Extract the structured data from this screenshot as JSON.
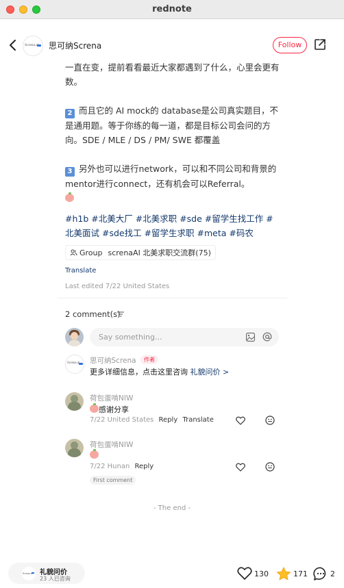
{
  "window": {
    "title": "rednote"
  },
  "header": {
    "author_name": "思可纳Screna",
    "follow_label": "Follow",
    "avatar_logo_text": "Screna.ai"
  },
  "post": {
    "para1": "一直在变，提前看看最近大家都遇到了什么，心里会更有数。",
    "para2_num": "2",
    "para2": "而且它的 AI mock的 database是公司真实题目，不是通用题。等于你练的每一道，都是目标公司会问的方向。SDE / MLE / DS / PM/ SWE 都覆盖",
    "para3_num": "3",
    "para3": "另外也可以进行network，可以和不同公司和背景的mentor进行connect，还有机会可以Referral。",
    "hashtags": "#h1b #北美大厂 #北美求职 #sde #留学生找工作 #北美面试 #sde找工 #留学生求职 #meta #码农",
    "group_label": "Group",
    "group_name": "screnaAI 北美求职交流群(75)",
    "translate_label": "Translate",
    "edited": "Last edited 7/22 United States"
  },
  "comments_section": {
    "count_label": "2 comment(s)",
    "input_placeholder": "Say something..."
  },
  "comments": [
    {
      "name": "思可纳Screna",
      "tag": "作者",
      "text": "更多详细信息，点击这里咨询",
      "link": "礼貌问价 >"
    },
    {
      "name": "荷包蛋啃NIW",
      "text": "感谢分享",
      "meta": "7/22 United States",
      "reply": "Reply",
      "translate": "Translate"
    },
    {
      "name": "荷包蛋啃NIW",
      "text": "",
      "meta": "7/22 Hunan",
      "reply": "Reply",
      "chip": "First comment"
    }
  ],
  "end_label": "- The end -",
  "bottom": {
    "card_title": "礼貌问价",
    "card_sub": "23 人已咨询",
    "likes": "130",
    "favorites": "171",
    "comments": "2"
  },
  "colors": {
    "brand_red": "#ff2442",
    "link_blue": "#13386c",
    "favorite_yellow": "#fbbf24"
  }
}
